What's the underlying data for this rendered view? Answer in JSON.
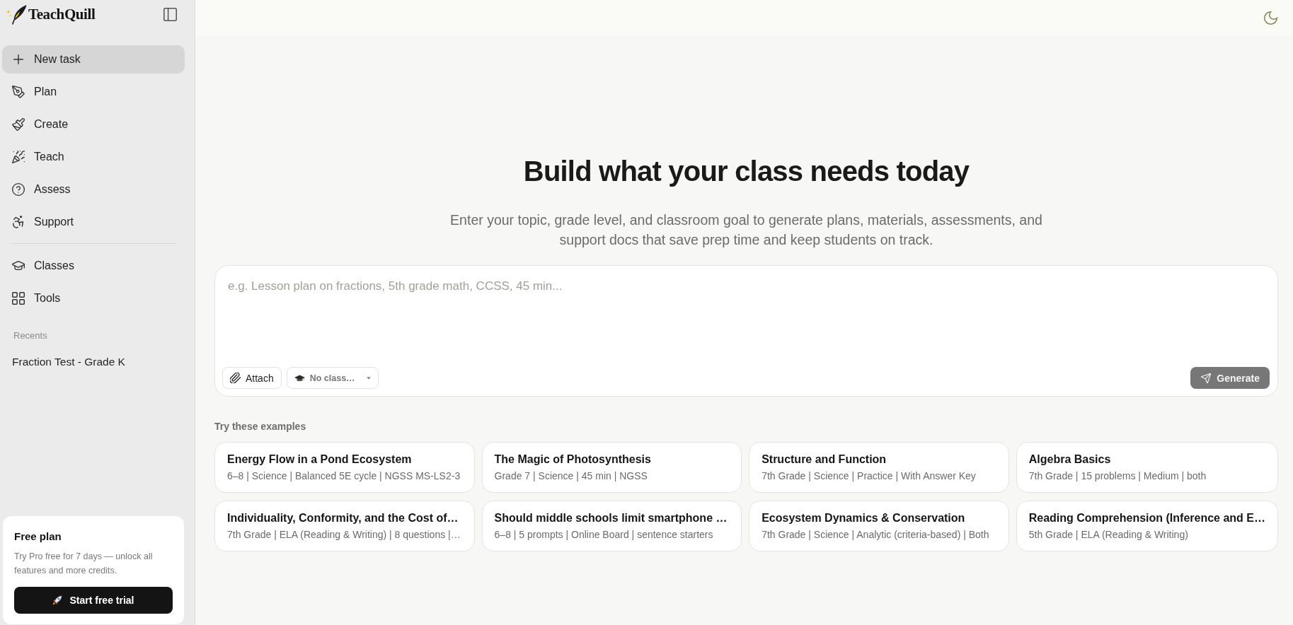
{
  "sidebar": {
    "app_name": "TeachQuill",
    "nav": [
      {
        "label": "New task",
        "selected": true
      },
      {
        "label": "Plan",
        "selected": false
      },
      {
        "label": "Create",
        "selected": false
      },
      {
        "label": "Teach",
        "selected": false
      },
      {
        "label": "Assess",
        "selected": false
      },
      {
        "label": "Support",
        "selected": false
      }
    ],
    "nav_secondary": [
      {
        "label": "Classes",
        "selected": false
      },
      {
        "label": "Tools",
        "selected": false
      }
    ],
    "recents": {
      "title": "Recents",
      "items": [
        {
          "label": "Fraction Test - Grade K",
          "selected": false
        }
      ]
    },
    "plan_card": {
      "title": "Free plan",
      "text": "Try Pro free for 7 days — unlock all features and more credits.",
      "button": "Start free trial"
    }
  },
  "main": {
    "heading": "Build what your class needs today",
    "subtitle": "Enter your topic, grade level, and classroom goal to generate plans, materials, assessments, and support docs that save prep time and keep students on track.",
    "composer": {
      "placeholder": "e.g. Lesson plan on fractions, 5th grade math, CCSS, 45 min...",
      "attach": "Attach",
      "class_select": "No class…",
      "generate": {
        "label": "Generate",
        "disabled": true
      }
    },
    "examples": {
      "title": "Try these examples",
      "cards": [
        {
          "title": "Energy Flow in a Pond Ecosystem",
          "details": "6–8 | Science | Balanced 5E cycle | NGSS MS-LS2-3"
        },
        {
          "title": "The Magic of Photosynthesis",
          "details": "Grade 7 | Science | 45 min | NGSS"
        },
        {
          "title": "Structure and Function",
          "details": "7th Grade | Science | Practice | With Answer Key"
        },
        {
          "title": "Algebra Basics",
          "details": "7th Grade | 15 problems | Medium | both"
        },
        {
          "title": "Individuality, Conformity, and the Cost of…",
          "details": "7th Grade | ELA (Reading & Writing) | 8 questions |…"
        },
        {
          "title": "Should middle schools limit smartphone …",
          "details": "6–8 | 5 prompts | Online Board | sentence starters"
        },
        {
          "title": "Ecosystem Dynamics & Conservation",
          "details": "7th Grade | Science | Analytic (criteria-based) | Both"
        },
        {
          "title": "Reading Comprehension (Inference and E…",
          "details": "5th Grade | ELA (Reading & Writing)"
        }
      ]
    }
  }
}
